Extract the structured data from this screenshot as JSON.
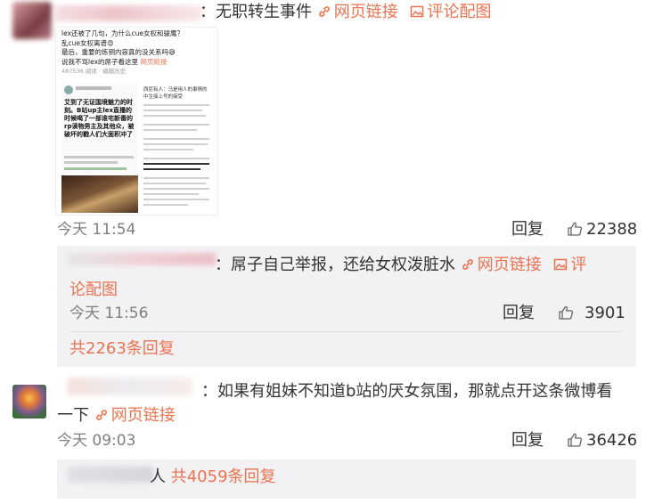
{
  "comment1": {
    "text": "：无职转生事件",
    "link_label": "网页链接",
    "img_label": "评论配图",
    "image": {
      "lines": [
        "lex还被了几句，为什么cue女权和骏鹰？",
        "乱cue女权离谱😡",
        "最后，重要的炼铜内容真的没关系吗😅",
        "说我不骂lex的屌子看这里",
        "网页链接"
      ],
      "stats": "487536 阅读  · 编辑历史",
      "left_text": "艾到了无证国境魅力的时刻。B站up主lex直播的时候喝了一部谁宅新番的rp读物男主及其他众，被破坏的戳人们大面积冲了",
      "right_text": "西尼有人：马是用人的事情的中生接上号的接受"
    },
    "time": "今天 11:54",
    "reply": "回复",
    "likes": "22388"
  },
  "reply1": {
    "text": "：屌子自己举报，还给女权泼脏水",
    "link_label": "网页链接",
    "img_label_a": "评",
    "img_label_b": "论配图",
    "time": "今天 11:56",
    "reply": "回复",
    "likes": "3901",
    "more": "共2263条回复"
  },
  "comment2": {
    "text_a": "：如果有姐妹不知道b站的厌女氛围，那就点开这条微博看",
    "text_b": "一下",
    "link_label": "网页链接",
    "time": "今天 09:03",
    "reply": "回复",
    "likes": "36426",
    "more_prefix": "人",
    "more": "共4059条回复"
  },
  "colors": {
    "link": "#eb7350",
    "meta": "#808080",
    "reply_bg": "#f2f2f5"
  }
}
